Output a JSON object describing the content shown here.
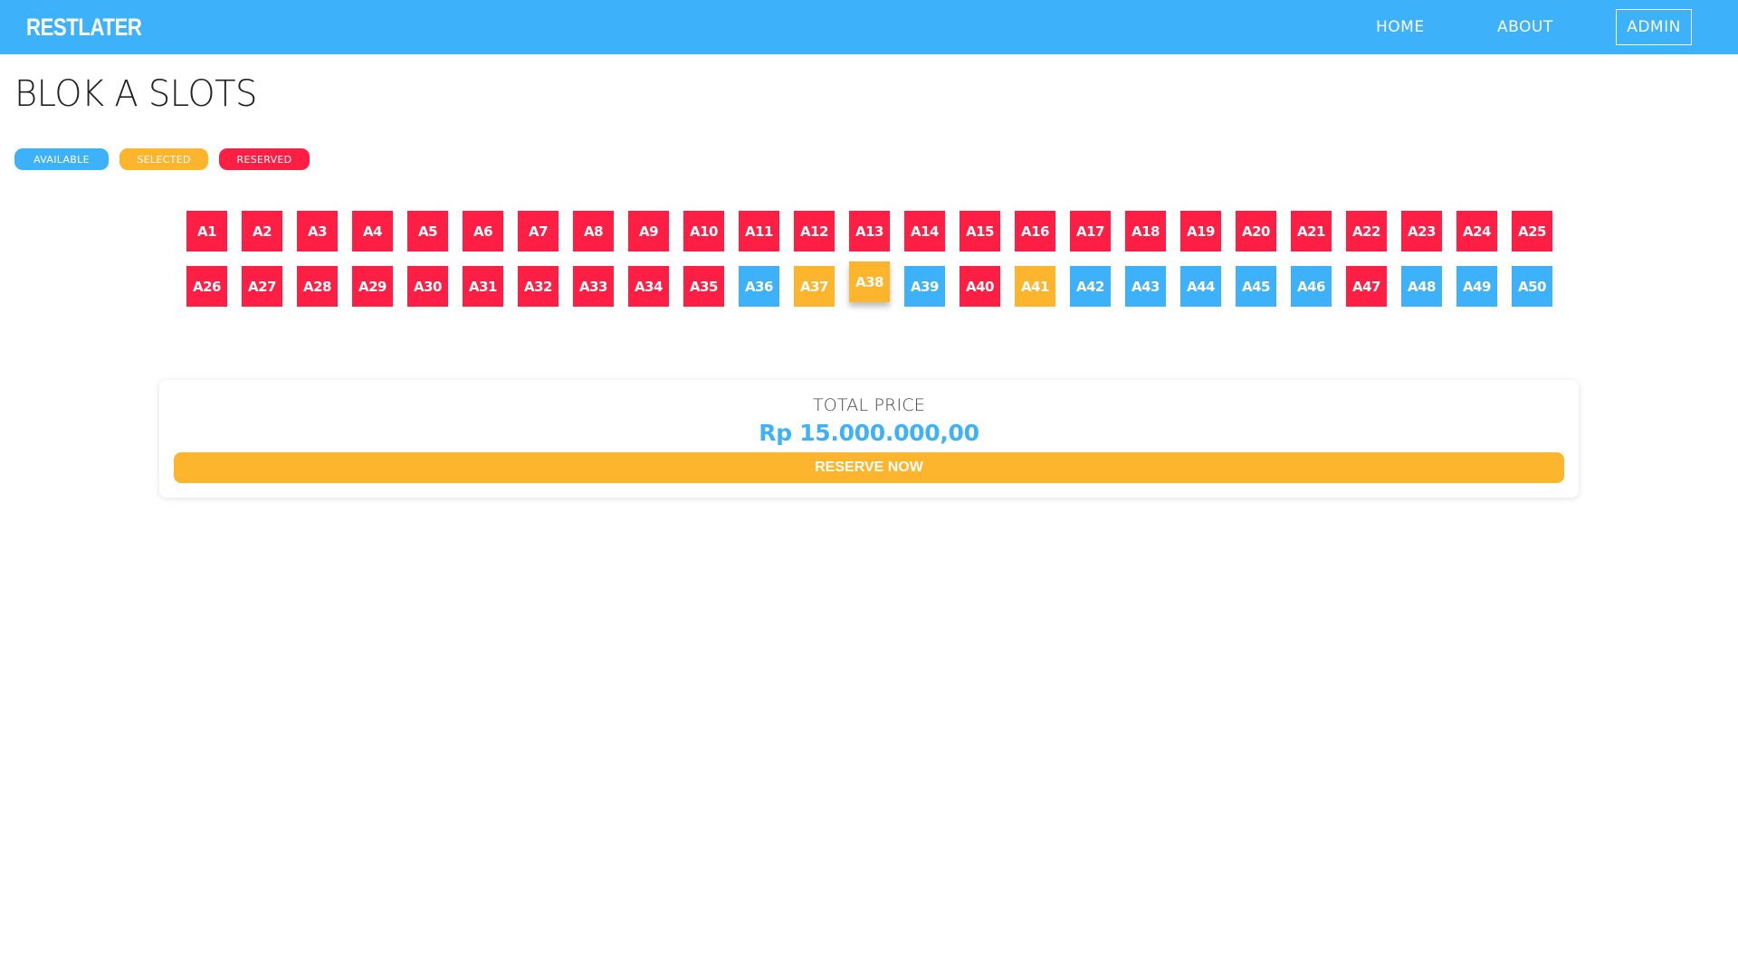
{
  "navbar": {
    "brand": "RESTLATER",
    "links": {
      "home": "HOME",
      "about": "ABOUT",
      "admin": "ADMIN"
    }
  },
  "page": {
    "title": "BLOK A SLOTS"
  },
  "legend": {
    "available": "AVAILABLE",
    "selected": "SELECTED",
    "reserved": "RESERVED"
  },
  "colors": {
    "available": "#3eb1fb",
    "selected": "#fdb52e",
    "reserved": "#ff1f44"
  },
  "slots": [
    {
      "label": "A1",
      "status": "reserved"
    },
    {
      "label": "A2",
      "status": "reserved"
    },
    {
      "label": "A3",
      "status": "reserved"
    },
    {
      "label": "A4",
      "status": "reserved"
    },
    {
      "label": "A5",
      "status": "reserved"
    },
    {
      "label": "A6",
      "status": "reserved"
    },
    {
      "label": "A7",
      "status": "reserved"
    },
    {
      "label": "A8",
      "status": "reserved"
    },
    {
      "label": "A9",
      "status": "reserved"
    },
    {
      "label": "A10",
      "status": "reserved"
    },
    {
      "label": "A11",
      "status": "reserved"
    },
    {
      "label": "A12",
      "status": "reserved"
    },
    {
      "label": "A13",
      "status": "reserved"
    },
    {
      "label": "A14",
      "status": "reserved"
    },
    {
      "label": "A15",
      "status": "reserved"
    },
    {
      "label": "A16",
      "status": "reserved"
    },
    {
      "label": "A17",
      "status": "reserved"
    },
    {
      "label": "A18",
      "status": "reserved"
    },
    {
      "label": "A19",
      "status": "reserved"
    },
    {
      "label": "A20",
      "status": "reserved"
    },
    {
      "label": "A21",
      "status": "reserved"
    },
    {
      "label": "A22",
      "status": "reserved"
    },
    {
      "label": "A23",
      "status": "reserved"
    },
    {
      "label": "A24",
      "status": "reserved"
    },
    {
      "label": "A25",
      "status": "reserved"
    },
    {
      "label": "A26",
      "status": "reserved"
    },
    {
      "label": "A27",
      "status": "reserved"
    },
    {
      "label": "A28",
      "status": "reserved"
    },
    {
      "label": "A29",
      "status": "reserved"
    },
    {
      "label": "A30",
      "status": "reserved"
    },
    {
      "label": "A31",
      "status": "reserved"
    },
    {
      "label": "A32",
      "status": "reserved"
    },
    {
      "label": "A33",
      "status": "reserved"
    },
    {
      "label": "A34",
      "status": "reserved"
    },
    {
      "label": "A35",
      "status": "reserved"
    },
    {
      "label": "A36",
      "status": "available"
    },
    {
      "label": "A37",
      "status": "selected"
    },
    {
      "label": "A38",
      "status": "selected",
      "hovered": true
    },
    {
      "label": "A39",
      "status": "available"
    },
    {
      "label": "A40",
      "status": "reserved"
    },
    {
      "label": "A41",
      "status": "selected"
    },
    {
      "label": "A42",
      "status": "available"
    },
    {
      "label": "A43",
      "status": "available"
    },
    {
      "label": "A44",
      "status": "available"
    },
    {
      "label": "A45",
      "status": "available"
    },
    {
      "label": "A46",
      "status": "available"
    },
    {
      "label": "A47",
      "status": "reserved"
    },
    {
      "label": "A48",
      "status": "available"
    },
    {
      "label": "A49",
      "status": "available"
    },
    {
      "label": "A50",
      "status": "available"
    }
  ],
  "summary": {
    "total_label": "TOTAL PRICE",
    "total_value": "Rp 15.000.000,00",
    "reserve_label": "RESERVE NOW"
  }
}
